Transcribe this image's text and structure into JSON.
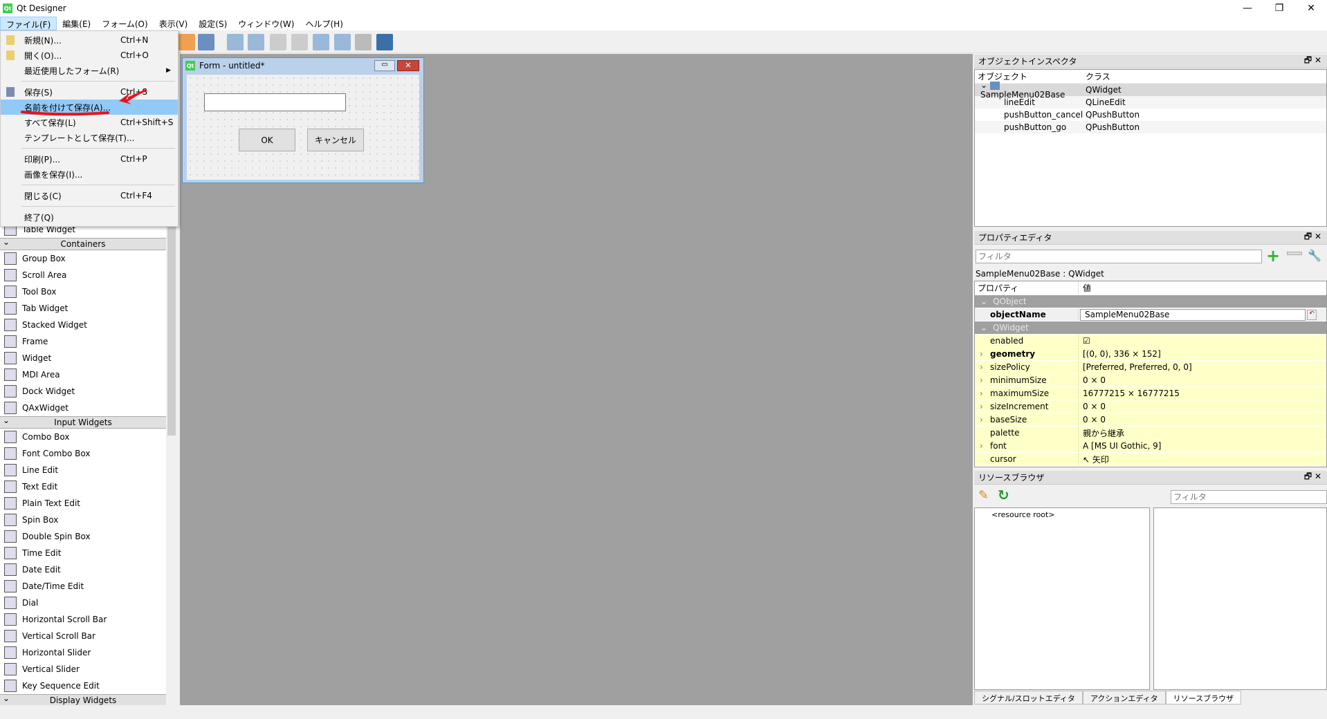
{
  "app": {
    "title": "Qt Designer",
    "logo": "Qt",
    "controls": [
      "minimize-icon",
      "restore-icon",
      "close-icon"
    ]
  },
  "menubar": [
    "ファイル(F)",
    "編集(E)",
    "フォーム(O)",
    "表示(V)",
    "設定(S)",
    "ウィンドウ(W)",
    "ヘルプ(H)"
  ],
  "file_menu": [
    {
      "label": "新規(N)...",
      "shortcut": "Ctrl+N",
      "icon": "new-file-icon"
    },
    {
      "label": "開く(O)...",
      "shortcut": "Ctrl+O",
      "icon": "open-folder-icon"
    },
    {
      "label": "最近使用したフォーム(R)",
      "shortcut": "",
      "submenu": true
    },
    {
      "sep": true
    },
    {
      "label": "保存(S)",
      "shortcut": "Ctrl+S",
      "icon": "save-icon"
    },
    {
      "label": "名前を付けて保存(A)...",
      "shortcut": "",
      "highlighted": true
    },
    {
      "label": "すべて保存(L)",
      "shortcut": "Ctrl+Shift+S"
    },
    {
      "label": "テンプレートとして保存(T)...",
      "shortcut": ""
    },
    {
      "sep": true
    },
    {
      "label": "印刷(P)...",
      "shortcut": "Ctrl+P"
    },
    {
      "label": "画像を保存(I)...",
      "shortcut": ""
    },
    {
      "sep": true
    },
    {
      "label": "閉じる(C)",
      "shortcut": "Ctrl+F4"
    },
    {
      "sep": true
    },
    {
      "label": "終了(Q)",
      "shortcut": ""
    }
  ],
  "annotation_color": "#e8141a",
  "widget_box": [
    {
      "label": "Table Widget"
    },
    {
      "category": "Containers"
    },
    {
      "label": "Group Box"
    },
    {
      "label": "Scroll Area"
    },
    {
      "label": "Tool Box"
    },
    {
      "label": "Tab Widget"
    },
    {
      "label": "Stacked Widget"
    },
    {
      "label": "Frame"
    },
    {
      "label": "Widget"
    },
    {
      "label": "MDI Area"
    },
    {
      "label": "Dock Widget"
    },
    {
      "label": "QAxWidget"
    },
    {
      "category": "Input Widgets"
    },
    {
      "label": "Combo Box"
    },
    {
      "label": "Font Combo Box"
    },
    {
      "label": "Line Edit"
    },
    {
      "label": "Text Edit"
    },
    {
      "label": "Plain Text Edit"
    },
    {
      "label": "Spin Box"
    },
    {
      "label": "Double Spin Box"
    },
    {
      "label": "Time Edit"
    },
    {
      "label": "Date Edit"
    },
    {
      "label": "Date/Time Edit"
    },
    {
      "label": "Dial"
    },
    {
      "label": "Horizontal Scroll Bar"
    },
    {
      "label": "Vertical Scroll Bar"
    },
    {
      "label": "Horizontal Slider"
    },
    {
      "label": "Vertical Slider"
    },
    {
      "label": "Key Sequence Edit"
    },
    {
      "category": "Display Widgets"
    }
  ],
  "form": {
    "title": "Form - untitled*",
    "ok": "OK",
    "cancel": "キャンセル"
  },
  "object_inspector": {
    "title": "オブジェクトインスペクタ",
    "col_object": "オブジェクト",
    "col_class": "クラス",
    "root": {
      "name": "SampleMenu02Base",
      "class": "QWidget"
    },
    "children": [
      {
        "name": "lineEdit",
        "class": "QLineEdit"
      },
      {
        "name": "pushButton_cancel",
        "class": "QPushButton"
      },
      {
        "name": "pushButton_go",
        "class": "QPushButton"
      }
    ]
  },
  "property_editor": {
    "title": "プロパティエディタ",
    "filter_placeholder": "フィルタ",
    "context": "SampleMenu02Base : QWidget",
    "col_prop": "プロパティ",
    "col_value": "値",
    "rows": [
      {
        "cat": "QObject"
      },
      {
        "k": "objectName",
        "v": "SampleMenu02Base",
        "bold": true,
        "edit": true
      },
      {
        "cat": "QWidget"
      },
      {
        "k": "enabled",
        "v": "☑"
      },
      {
        "k": "geometry",
        "v": "[(0, 0), 336 × 152]",
        "bold": true,
        "exp": true
      },
      {
        "k": "sizePolicy",
        "v": "[Preferred, Preferred, 0, 0]",
        "exp": true
      },
      {
        "k": "minimumSize",
        "v": "0 × 0",
        "exp": true
      },
      {
        "k": "maximumSize",
        "v": "16777215 × 16777215",
        "exp": true
      },
      {
        "k": "sizeIncrement",
        "v": "0 × 0",
        "exp": true
      },
      {
        "k": "baseSize",
        "v": "0 × 0",
        "exp": true
      },
      {
        "k": "palette",
        "v": "親から継承"
      },
      {
        "k": "font",
        "v": "A  [MS UI Gothic, 9]",
        "exp": true
      },
      {
        "k": "cursor",
        "v": "↖  矢印"
      }
    ]
  },
  "resource_browser": {
    "title": "リソースブラウザ",
    "filter_placeholder": "フィルタ",
    "root": "<resource root>"
  },
  "bottom_tabs": [
    "シグナル/スロットエディタ",
    "アクションエディタ",
    "リソースブラウザ"
  ]
}
